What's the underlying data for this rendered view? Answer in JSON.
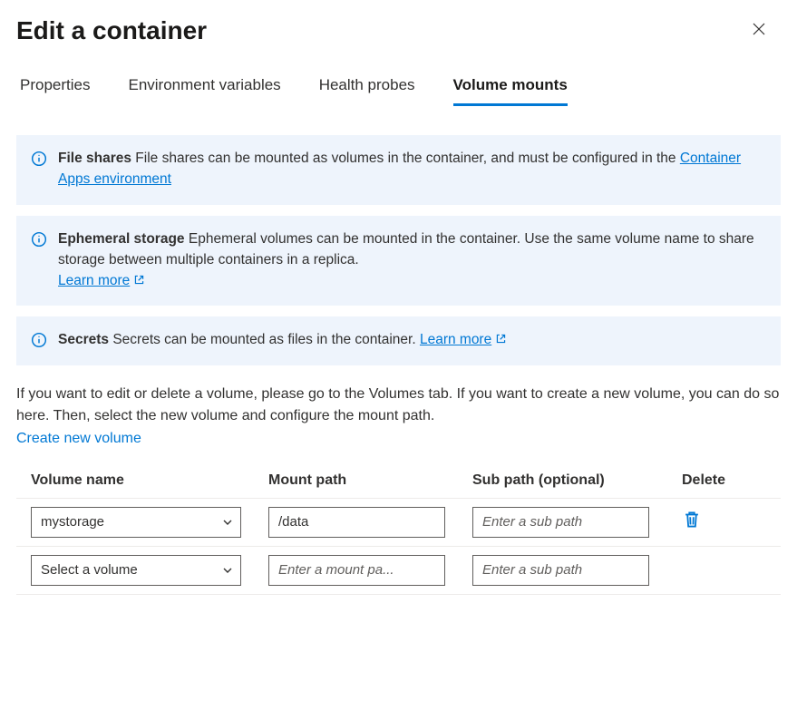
{
  "header": {
    "title": "Edit a container"
  },
  "tabs": {
    "items": [
      {
        "label": "Properties",
        "active": false
      },
      {
        "label": "Environment variables",
        "active": false
      },
      {
        "label": "Health probes",
        "active": false
      },
      {
        "label": "Volume mounts",
        "active": true
      }
    ]
  },
  "info_boxes": [
    {
      "title": "File shares",
      "body_before_link": " File shares can be mounted as volumes in the container, and must be configured in the  ",
      "link_text": "Container Apps environment",
      "body_after_link": "",
      "external_icon": false
    },
    {
      "title": "Ephemeral storage",
      "body_before_link": " Ephemeral volumes can be mounted in the container. Use the same volume name to share storage between multiple containers in a replica. ",
      "link_text": "Learn more",
      "body_after_link": "",
      "external_icon": true,
      "link_on_new_line": true
    },
    {
      "title": "Secrets",
      "body_before_link": " Secrets can be mounted as files in the container.  ",
      "link_text": "Learn more",
      "body_after_link": "",
      "external_icon": true
    }
  ],
  "help": {
    "text": "If you want to edit or delete a volume, please go to the Volumes tab. If you want to create a new volume, you can do so here. Then, select the new volume and configure the mount path.",
    "create_link": "Create new volume"
  },
  "table": {
    "headers": {
      "name": "Volume name",
      "mount": "Mount path",
      "sub": "Sub path (optional)",
      "delete": "Delete"
    },
    "rows": [
      {
        "volume": "mystorage",
        "volume_is_placeholder": false,
        "mount": "/data",
        "mount_placeholder": "Enter a mount pa...",
        "sub": "",
        "sub_placeholder": "Enter a sub path",
        "deletable": true
      },
      {
        "volume": "Select a volume",
        "volume_is_placeholder": true,
        "mount": "",
        "mount_placeholder": "Enter a mount pa...",
        "sub": "",
        "sub_placeholder": "Enter a sub path",
        "deletable": false
      }
    ]
  }
}
